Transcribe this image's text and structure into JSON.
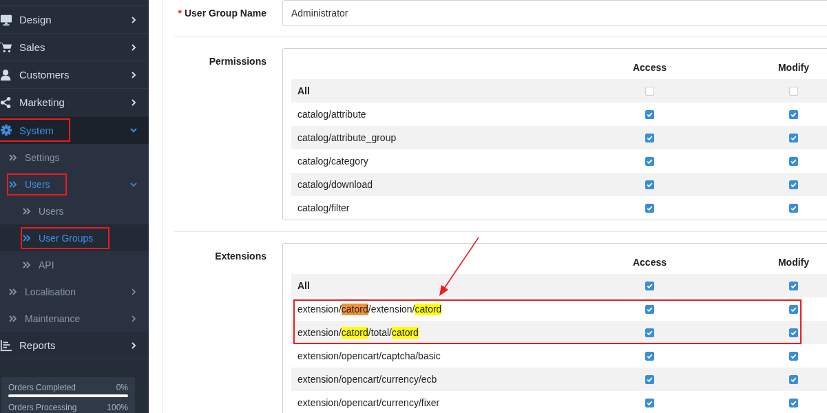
{
  "sidebar": {
    "items": [
      {
        "label": "Design",
        "kind": "menu",
        "expanded": false,
        "selected": false,
        "boxed": false
      },
      {
        "label": "Sales",
        "kind": "menu",
        "expanded": false,
        "selected": false,
        "boxed": false
      },
      {
        "label": "Customers",
        "kind": "menu",
        "expanded": false,
        "selected": false,
        "boxed": false
      },
      {
        "label": "Marketing",
        "kind": "menu",
        "expanded": false,
        "selected": false,
        "boxed": false
      },
      {
        "label": "System",
        "kind": "menu",
        "expanded": true,
        "selected": true,
        "boxed": true,
        "children": [
          {
            "label": "Settings",
            "kind": "link",
            "expanded": false,
            "selected": false,
            "boxed": false
          },
          {
            "label": "Users",
            "kind": "menu",
            "expanded": true,
            "selected": true,
            "boxed": true,
            "children": [
              {
                "label": "Users",
                "selected": false,
                "boxed": false
              },
              {
                "label": "User Groups",
                "selected": true,
                "boxed": true
              },
              {
                "label": "API",
                "selected": false,
                "boxed": false
              }
            ]
          },
          {
            "label": "Localisation",
            "kind": "menu",
            "expanded": false,
            "selected": false,
            "boxed": false
          },
          {
            "label": "Maintenance",
            "kind": "menu",
            "expanded": false,
            "selected": false,
            "boxed": false
          }
        ]
      },
      {
        "label": "Reports",
        "kind": "menu",
        "expanded": false,
        "selected": false,
        "boxed": false
      }
    ],
    "stats": [
      {
        "label": "Orders Completed",
        "value": "0%",
        "level": 0
      },
      {
        "label": "Orders Processing",
        "value": "100%"
      }
    ]
  },
  "form": {
    "required_mark": "*",
    "name_label": "User Group Name",
    "name_value": "Administrator",
    "sections": [
      {
        "label": "Permissions",
        "arrow": false,
        "headers": [
          "Access",
          "Modify"
        ],
        "rows": [
          {
            "kind": "all",
            "segments": [
              {
                "text": "All"
              }
            ],
            "access": false,
            "modify": false,
            "boxed": false
          },
          {
            "kind": "path",
            "segments": [
              {
                "text": "catalog/attribute"
              }
            ],
            "access": true,
            "modify": true,
            "boxed": false
          },
          {
            "kind": "path",
            "segments": [
              {
                "text": "catalog/attribute_group"
              }
            ],
            "access": true,
            "modify": true,
            "boxed": false
          },
          {
            "kind": "path",
            "segments": [
              {
                "text": "catalog/category"
              }
            ],
            "access": true,
            "modify": true,
            "boxed": false
          },
          {
            "kind": "path",
            "segments": [
              {
                "text": "catalog/download"
              }
            ],
            "access": true,
            "modify": true,
            "boxed": false
          },
          {
            "kind": "path",
            "segments": [
              {
                "text": "catalog/filter"
              }
            ],
            "access": true,
            "modify": true,
            "boxed": false
          }
        ]
      },
      {
        "label": "Extensions",
        "arrow": true,
        "headers": [
          "Access",
          "Modify"
        ],
        "rows": [
          {
            "kind": "all",
            "segments": [
              {
                "text": "All"
              }
            ],
            "access": true,
            "modify": true,
            "boxed": false
          },
          {
            "kind": "path",
            "segments": [
              {
                "text": "extension/"
              },
              {
                "text": "catord",
                "color": "#f0913a"
              },
              {
                "text": "/extension/"
              },
              {
                "text": "catord",
                "color": "#ffff00"
              }
            ],
            "access": true,
            "modify": true,
            "boxed": true
          },
          {
            "kind": "path",
            "segments": [
              {
                "text": "extension/"
              },
              {
                "text": "catord",
                "color": "#ffff00"
              },
              {
                "text": "/total/"
              },
              {
                "text": "catord",
                "color": "#ffff00"
              }
            ],
            "access": true,
            "modify": true,
            "boxed": true
          },
          {
            "kind": "path",
            "segments": [
              {
                "text": "extension/opencart/captcha/basic"
              }
            ],
            "access": true,
            "modify": true,
            "boxed": false
          },
          {
            "kind": "path",
            "segments": [
              {
                "text": "extension/opencart/currency/ecb"
              }
            ],
            "access": true,
            "modify": true,
            "boxed": false
          },
          {
            "kind": "path",
            "segments": [
              {
                "text": "extension/opencart/currency/fixer"
              }
            ],
            "access": true,
            "modify": true,
            "boxed": false
          }
        ]
      }
    ]
  }
}
